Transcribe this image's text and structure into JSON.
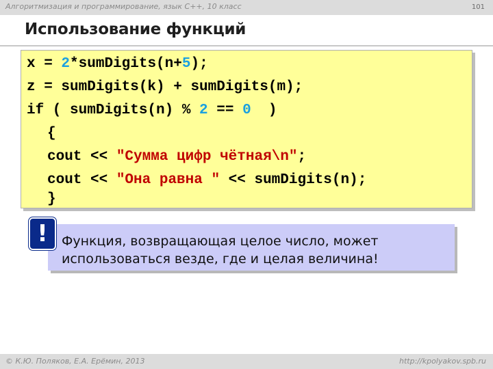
{
  "header": {
    "course": "Алгоритмизация и программирование, язык C++, 10 класс",
    "page_number": "101"
  },
  "slide": {
    "title": "Использование функций"
  },
  "code": {
    "line1": {
      "a": "x = ",
      "n1": "2",
      "b": "*sumDigits(n+",
      "n2": "5",
      "c": ");"
    },
    "line2": "z = sumDigits(k) + sumDigits(m);",
    "line3": {
      "a": "if ( sumDigits(n) % ",
      "n1": "2",
      "b": " == ",
      "n2": "0",
      "c": "  )"
    },
    "line4": "{",
    "line5": {
      "a": "cout << ",
      "s": "\"Сумма цифр чётная\\n\"",
      "c": ";"
    },
    "line6": {
      "a": "cout << ",
      "s": "\"Она равна \"",
      "c": " << sumDigits(n);"
    },
    "line7": "}"
  },
  "note": {
    "icon": "!",
    "text": "Функция, возвращающая целое число, может использоваться везде, где и целая величина!"
  },
  "footer": {
    "copyright": "© К.Ю. Поляков, Е.А. Ерёмин, 2013",
    "site": "http://kpolyakov.spb.ru"
  }
}
